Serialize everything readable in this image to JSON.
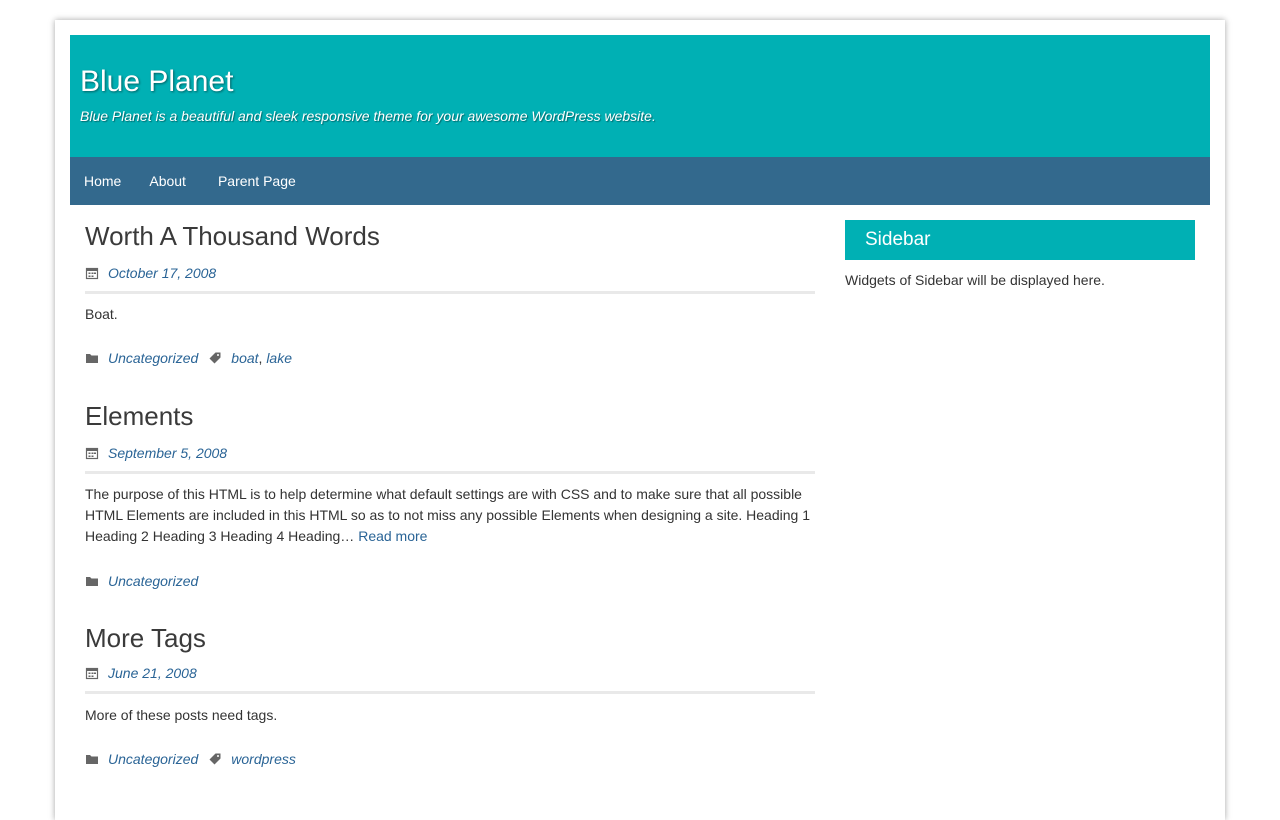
{
  "site": {
    "title": "Blue Planet",
    "description": "Blue Planet is a beautiful and sleek responsive theme for your awesome WordPress website."
  },
  "nav": {
    "items": [
      {
        "label": "Home"
      },
      {
        "label": "About"
      },
      {
        "label": "Parent Page"
      }
    ]
  },
  "posts": [
    {
      "title": "Worth A Thousand Words",
      "date": "October 17, 2008",
      "excerpt": "Boat.",
      "category": "Uncategorized",
      "tags": [
        "boat",
        "lake"
      ]
    },
    {
      "title": "Elements",
      "date": "September 5, 2008",
      "excerpt": "The purpose of this HTML is to help determine what default settings are with CSS and to make sure that all possible HTML Elements are included in this HTML so as to not miss any possible Elements when designing a site. Heading 1 Heading 2 Heading 3 Heading 4 Heading…",
      "read_more": "Read more",
      "category": "Uncategorized",
      "tags": []
    },
    {
      "title": "More Tags",
      "date": "June 21, 2008",
      "excerpt": "More of these posts need tags.",
      "category": "Uncategorized",
      "tags": [
        "wordpress"
      ]
    }
  ],
  "sidebar": {
    "title": "Sidebar",
    "text": "Widgets of Sidebar will be displayed here."
  },
  "icons": {
    "date": "calendar-icon",
    "category": "folder-icon",
    "tag": "tag-icon"
  },
  "colors": {
    "header_bg": "#00b0b4",
    "nav_bg": "#33698d",
    "link": "#2a6496"
  }
}
